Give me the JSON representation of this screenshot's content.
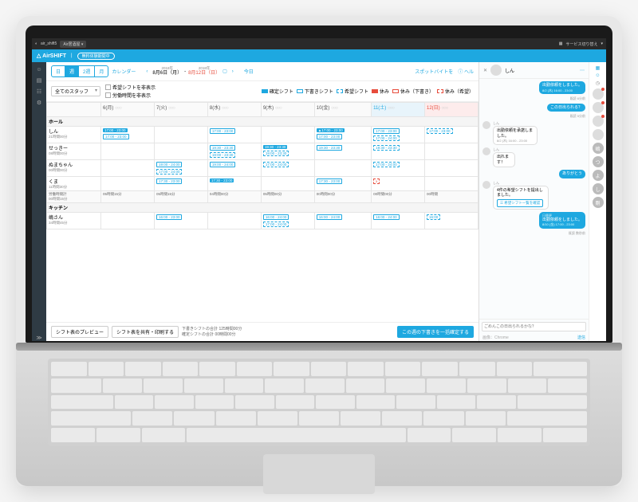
{
  "os": {
    "user": "air_shift5",
    "store": "Air居酒屋",
    "switch": "サービス切り替え"
  },
  "app": {
    "logo": "△ AirSHIFT",
    "statusPill": "無料体験期間中"
  },
  "rail_icons": [
    "user",
    "calendar",
    "doc",
    "settings"
  ],
  "toolbar": {
    "views": [
      "日",
      "週",
      "2週",
      "月"
    ],
    "active_view": "週",
    "calendar": "カレンダー",
    "year": "2018年",
    "range_from": "8月6日（月）",
    "range_to": "8月12日（日）",
    "today": "今日",
    "spot": "スポットバイトを",
    "help": "ヘル"
  },
  "filters": {
    "staff_select": "全てのスタッフ",
    "hide_request": "希望シフトを非表示",
    "hide_hours": "労働時間を非表示",
    "legend": {
      "confirmed": "確定シフト",
      "draft": "下書きシフト",
      "request": "希望シフト",
      "off": "休み",
      "off_draft": "休み（下書き）",
      "off_request": "休み（希望）"
    }
  },
  "days": [
    {
      "label": "6(月)",
      "cls": ""
    },
    {
      "label": "7(火)",
      "cls": ""
    },
    {
      "label": "8(水)",
      "cls": ""
    },
    {
      "label": "9(木)",
      "cls": ""
    },
    {
      "label": "10(金)",
      "cls": ""
    },
    {
      "label": "11(土)",
      "cls": "sat"
    },
    {
      "label": "12(日)",
      "cls": "sun"
    }
  ],
  "sections": {
    "hall": "ホール",
    "kitchen": "キッチン"
  },
  "staff": [
    {
      "name": "しん",
      "hours": "21時間00分",
      "cells": [
        [
          {
            "t": "17:00 - 23:00",
            "c": "s-conf"
          },
          {
            "t": "17:00 - 23:00",
            "c": "s-draft"
          }
        ],
        [],
        [
          {
            "t": "17:00 - 23:00",
            "c": "s-draft"
          }
        ],
        [],
        [
          {
            "t": "▲17:00 - 23:00",
            "c": "s-conf"
          },
          {
            "t": "17:00 - 23:00",
            "c": "s-draft"
          }
        ],
        [
          {
            "t": "17:00 - 23:00",
            "c": "s-draft"
          },
          {
            "t": "17:00 - 24:00",
            "c": "s-req"
          }
        ],
        [
          {
            "t": "17:00 - 23:00",
            "c": "s-req"
          }
        ]
      ]
    },
    {
      "name": "せっきー",
      "hours": "08時間00分",
      "cells": [
        [],
        [],
        [
          {
            "t": "19:30 - 23:30",
            "c": "s-draft"
          },
          {
            "t": "19:00 - 23:30",
            "c": "s-req"
          }
        ],
        [
          {
            "t": "19:30 - 23:30",
            "c": "s-conf"
          },
          {
            "t": "19:00 - 23:30",
            "c": "s-req"
          }
        ],
        [
          {
            "t": "19:30 - 23:30",
            "c": "s-draft"
          }
        ],
        [
          {
            "t": "19:30 - 23:30",
            "c": "s-req"
          }
        ],
        []
      ]
    },
    {
      "name": "ぬまちゃん",
      "hours": "00時間00分",
      "cells": [
        [],
        [
          {
            "t": "19:00 - 24:00",
            "c": "s-draft"
          },
          {
            "t": "17:00 - 24:00",
            "c": "s-req"
          }
        ],
        [
          {
            "t": "19:00 - 24:00",
            "c": "s-draft"
          }
        ],
        [
          {
            "t": "17:00 - 24:00",
            "c": "s-req"
          }
        ],
        [],
        [
          {
            "t": "17:00 - 24:00",
            "c": "s-req"
          }
        ],
        []
      ]
    },
    {
      "name": "くま",
      "hours": "11時間30分",
      "cells": [
        [],
        [
          {
            "t": "17:30 - 23:00",
            "c": "s-draft"
          }
        ],
        [
          {
            "t": "17:30 - 23:00",
            "c": "s-conf"
          }
        ],
        [],
        [
          {
            "t": "17:30 - 23:00",
            "c": "s-draft"
          }
        ],
        [
          {
            "t": "x",
            "c": "s-offr"
          }
        ],
        []
      ]
    }
  ],
  "work_totals": {
    "label": "労働時間計",
    "hours": "00時間15分",
    "cells": [
      "05時間15分",
      "05時間15分",
      "04時間00分",
      "05時間00分",
      "00時間00分",
      "00時間00分",
      "00時間"
    ]
  },
  "kitchen_staff": {
    "name": "嶋さん",
    "hours": "34時間45分",
    "cells": [
      [],
      [
        {
          "t": "16:00 - 23:00",
          "c": "s-draft"
        }
      ],
      [],
      [
        {
          "t": "16:00 - 24:00",
          "c": "s-draft"
        },
        {
          "t": "17:00 - 24:00",
          "c": "s-req"
        }
      ],
      [
        {
          "t": "16:00 - 24:00",
          "c": "s-draft"
        }
      ],
      [
        {
          "t": "16:00 - 24:00",
          "c": "s-draft"
        }
      ],
      [
        {
          "t": "16:00",
          "c": "s-req"
        }
      ]
    ]
  },
  "footer": {
    "preview": "シフト表のプレビュー",
    "share": "シフト表を共有・印刷する",
    "draft_total_label": "下書きシフトの合計",
    "draft_total": "125時間00分",
    "conf_total_label": "確定シフトの合計",
    "conf_total": "00時間00分",
    "confirm_btn": "この週の下書きを一括確定する"
  },
  "chat": {
    "name": "しん",
    "messages": [
      {
        "who": "me",
        "text": "出勤依頼をしました。",
        "meta": "8/2 (木) 16:00 - 23:00"
      },
      {
        "who": "meta",
        "text": "既読",
        "meta": "6分前"
      },
      {
        "who": "me",
        "text": "この日出られる？"
      },
      {
        "who": "meta",
        "text": "既読 5分前"
      },
      {
        "who": "them",
        "from": "しん",
        "text": "出勤依頼を承諾しました。",
        "meta": "8/2 (木) 16:00 - 23:00"
      },
      {
        "who": "them",
        "from": "しん",
        "text": "出れます！"
      },
      {
        "who": "me",
        "text": "ありがとう"
      },
      {
        "who": "them",
        "from": "しん",
        "text": "4件の希望シフトを提出しました。",
        "chip": "希望シフト一覧を確認"
      },
      {
        "who": "me",
        "text": "出勤依頼をしました。",
        "meta": "8/10 (金) 17:00 - 23:00",
        "label": "日替更"
      },
      {
        "who": "meta",
        "text": "既読 数秒前"
      }
    ],
    "input_placeholder": "ごめんこの日出られるかな？",
    "send": "送信",
    "rail_labels": [
      "嶋",
      "つ",
      "よ",
      "し",
      "剛"
    ],
    "footer_note": "画像：Chrome"
  }
}
